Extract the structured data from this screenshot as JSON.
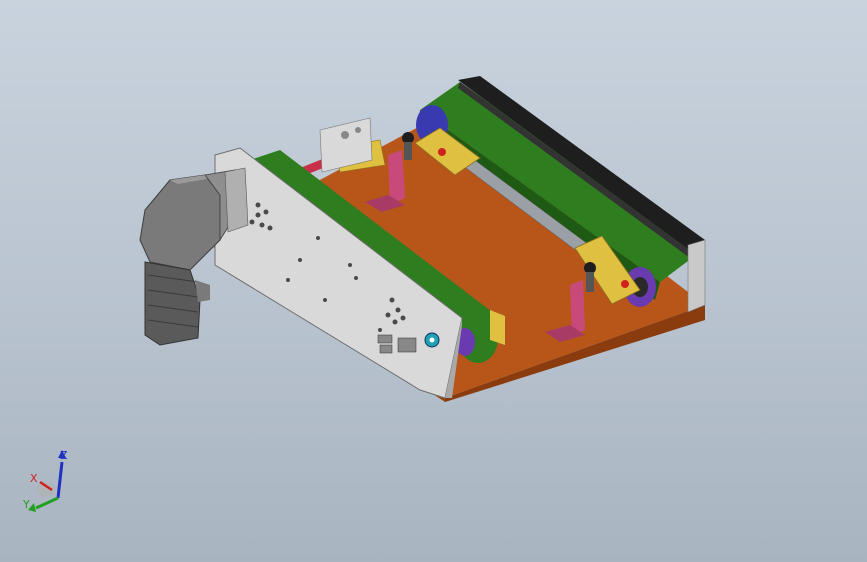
{
  "viewport": {
    "background_top": "#c9d3de",
    "background_bottom": "#a9b4c1"
  },
  "colors": {
    "belt_green": "#2e7d1f",
    "belt_green_dark": "#1f5a14",
    "base_orange": "#b8561a",
    "base_orange_dark": "#8a3c0e",
    "plate_gray": "#d9d9d9",
    "motor_gray": "#6e6e6e",
    "bracket_pink": "#c84a7a",
    "shaft_red": "#c8304a",
    "block_yellow": "#e0c040",
    "pulley_blue": "#3a3ab0",
    "rail_black": "#1e1e1e",
    "axis_x": "#d02020",
    "axis_y": "#20a020",
    "axis_z": "#2030c0"
  },
  "triad": {
    "x_label": "X",
    "y_label": "Y",
    "z_label": "Z"
  }
}
